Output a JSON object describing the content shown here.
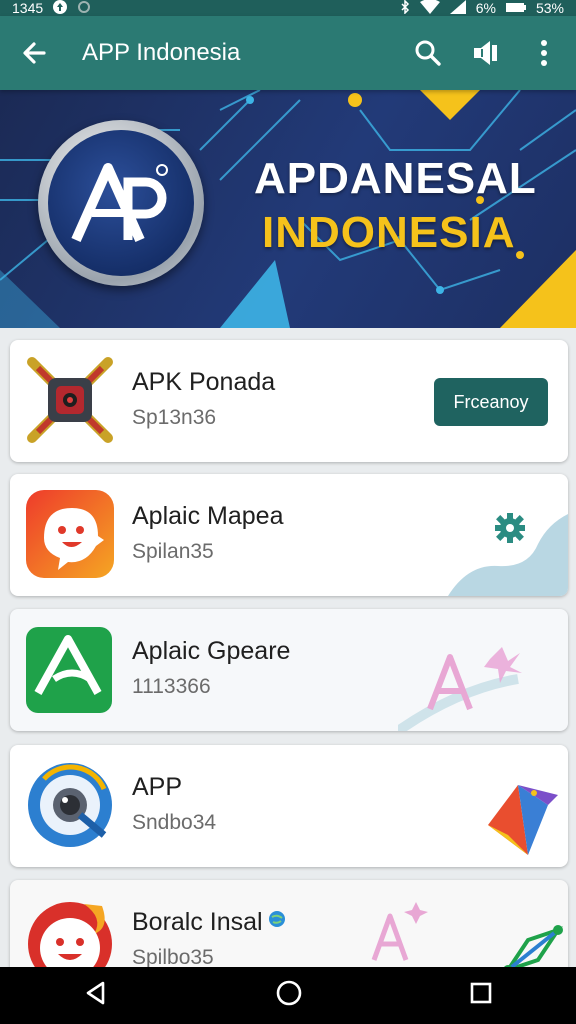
{
  "status_bar": {
    "time": "1345",
    "battery_small": "6%",
    "battery_main": "53%"
  },
  "toolbar": {
    "title": "APP Indonesia",
    "icons": [
      "back-arrow-icon",
      "search-icon",
      "speaker-icon",
      "more-vert-icon"
    ]
  },
  "banner": {
    "line1": "APDANESAL",
    "line2": "INDONESIA",
    "accent": "#f5c21b"
  },
  "apps": [
    {
      "name": "APK Ponada",
      "sub": "Sp13n36",
      "action_label": "Frceanoy"
    },
    {
      "name": "Aplaic Mapea",
      "sub": "Spilan35"
    },
    {
      "name": "Aplaic Gpeare",
      "sub": "1113366"
    },
    {
      "name": "APP",
      "sub": "Sndbo34"
    },
    {
      "name": "Boralc Insal",
      "sub": "Spilbo35"
    }
  ],
  "colors": {
    "toolbar": "#2b7a73",
    "button": "#1f6360"
  }
}
